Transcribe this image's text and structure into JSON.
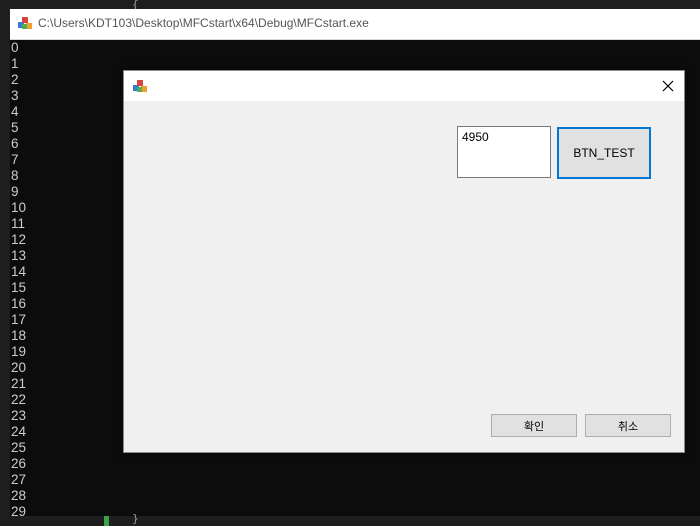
{
  "console": {
    "title": "C:\\Users\\KDT103\\Desktop\\MFCstart\\x64\\Debug\\MFCstart.exe",
    "lines": [
      "0",
      "1",
      "2",
      "3",
      "4",
      "5",
      "6",
      "7",
      "8",
      "9",
      "10",
      "11",
      "12",
      "13",
      "14",
      "15",
      "16",
      "17",
      "18",
      "19",
      "20",
      "21",
      "22",
      "23",
      "24",
      "25",
      "26",
      "27",
      "28",
      "29"
    ]
  },
  "editor": {
    "top_glyph": "{",
    "bottom_glyph": "}"
  },
  "dialog": {
    "result_value": "4950",
    "test_button_label": "BTN_TEST",
    "ok_label": "확인",
    "cancel_label": "취소"
  },
  "icons": {
    "app": "mfc-app-icon",
    "close": "close-icon"
  },
  "colors": {
    "console_bg": "#0c0c0c",
    "console_text": "#cccccc",
    "dialog_bg": "#f0f0f0",
    "focus_border": "#0078d7"
  }
}
